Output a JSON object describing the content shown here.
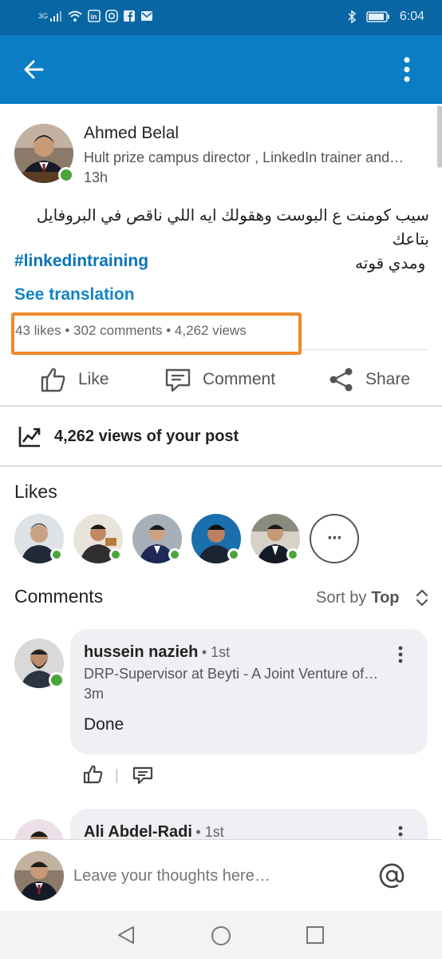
{
  "status_bar": {
    "network": "3G",
    "time": "6:04"
  },
  "post": {
    "author_name": "Ahmed Belal",
    "author_headline": "Hult prize campus director , LinkedIn trainer and…",
    "time": "13h",
    "body_line1": "سيب كومنت ع البوست وهقولك ايه اللي ناقص في البروفايل بتاعك",
    "body_line2": "ومدي قوته",
    "hashtag": "#linkedintraining",
    "see_translation": "See translation",
    "stats": "43 likes • 302 comments • 4,262 views"
  },
  "actions": {
    "like": "Like",
    "comment": "Comment",
    "share": "Share"
  },
  "views": {
    "text": "4,262 views of your post"
  },
  "likes": {
    "title": "Likes",
    "more": "···"
  },
  "comments": {
    "title": "Comments",
    "sort_label": "Sort by",
    "sort_value": "Top",
    "items": [
      {
        "name": "hussein nazieh",
        "degree": "• 1st",
        "headline": "DRP-Supervisor at Beyti - A Joint Venture of…",
        "time": "3m",
        "text": "Done"
      },
      {
        "name": "Ali Abdel-Radi",
        "degree": "• 1st"
      }
    ]
  },
  "composer": {
    "placeholder": "Leave your thoughts here…"
  },
  "colors": {
    "accent": "#0a7dc4",
    "online": "#4aa53a",
    "highlight": "#f08a2a"
  }
}
